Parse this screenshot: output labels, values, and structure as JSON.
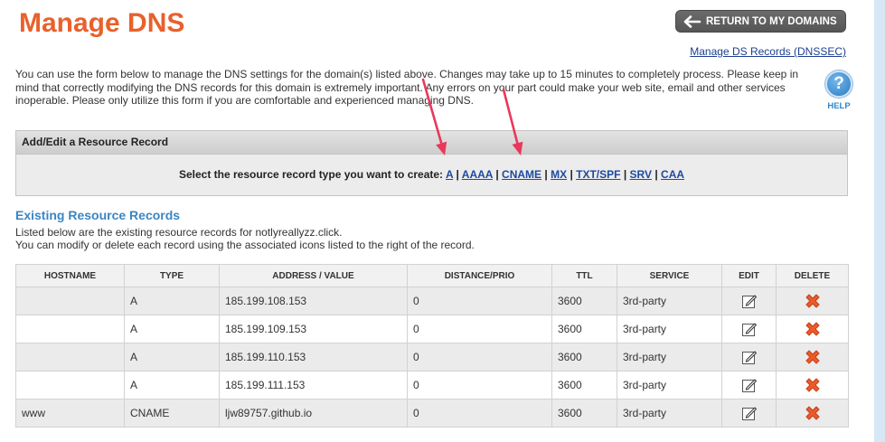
{
  "page": {
    "title": "Manage DNS"
  },
  "header": {
    "return_button": {
      "label": "RETURN TO MY DOMAINS",
      "icon": "arrow-left-icon"
    },
    "dnssec_link": "Manage DS Records (DNSSEC)"
  },
  "intro": {
    "lines": [
      "You can use the form below to manage the DNS settings for the domain(s) listed above. Changes may take up to 15 minutes to completely process. Please keep in",
      "mind that correctly modifying the DNS records for this domain is extremely important. Any errors on your part could make your web site, email and other services",
      "inoperable. Please only utilize this form if you are comfortable and experienced managing DNS."
    ]
  },
  "help": {
    "glyph": "?",
    "label": "HELP",
    "icon": "help-icon"
  },
  "add_edit": {
    "title": "Add/Edit a Resource Record",
    "prompt": "Select the resource record type you want to create:",
    "types": [
      "A",
      "AAAA",
      "CNAME",
      "MX",
      "TXT/SPF",
      "SRV",
      "CAA"
    ],
    "separator": "|"
  },
  "existing": {
    "title": "Existing Resource Records",
    "line1": "Listed below are the existing resource records for notlyreallyzz.click.",
    "line2": "You can modify or delete each record using the associated icons listed to the right of the record."
  },
  "table": {
    "columns": [
      "HOSTNAME",
      "TYPE",
      "ADDRESS / VALUE",
      "DISTANCE/PRIO",
      "TTL",
      "SERVICE",
      "EDIT",
      "DELETE"
    ],
    "rows": [
      {
        "hostname": "",
        "type": "A",
        "address": "185.199.108.153",
        "distance": "0",
        "ttl": "3600",
        "service": "3rd-party"
      },
      {
        "hostname": "",
        "type": "A",
        "address": "185.199.109.153",
        "distance": "0",
        "ttl": "3600",
        "service": "3rd-party"
      },
      {
        "hostname": "",
        "type": "A",
        "address": "185.199.110.153",
        "distance": "0",
        "ttl": "3600",
        "service": "3rd-party"
      },
      {
        "hostname": "",
        "type": "A",
        "address": "185.199.111.153",
        "distance": "0",
        "ttl": "3600",
        "service": "3rd-party"
      },
      {
        "hostname": "www",
        "type": "CNAME",
        "address": "ljw89757.github.io",
        "distance": "0",
        "ttl": "3600",
        "service": "3rd-party"
      }
    ],
    "edit_icon": "edit-icon",
    "delete_icon": "delete-icon"
  },
  "colors": {
    "title": "#e8612c",
    "section_heading": "#3a85c4",
    "link": "#1d4aa0",
    "button_bg": "#616161",
    "delete_icon": "#ec5a2a",
    "annotation_arrow": "#e8395b",
    "side_band": "#d6e7f6"
  }
}
